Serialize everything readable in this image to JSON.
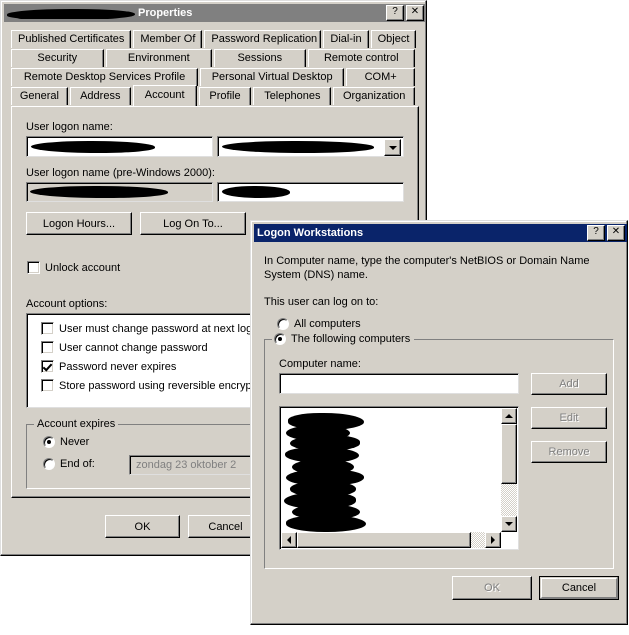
{
  "properties_window": {
    "title_suffix": "Properties",
    "title_redacted": true,
    "titlebar_buttons": [
      {
        "name": "help-button",
        "label": "?"
      },
      {
        "name": "close-button",
        "label": "✕"
      }
    ],
    "tab_rows": [
      [
        {
          "label": "Published Certificates",
          "active": false,
          "width": 124
        },
        {
          "label": "Member Of",
          "active": false,
          "width": 70
        },
        {
          "label": "Password Replication",
          "active": false,
          "width": 117
        },
        {
          "label": "Dial-in",
          "active": false,
          "width": 48
        },
        {
          "label": "Object",
          "active": false,
          "width": 45
        }
      ],
      [
        {
          "label": "Security",
          "active": false,
          "width": 93
        },
        {
          "label": "Environment",
          "active": false,
          "width": 107
        },
        {
          "label": "Sessions",
          "active": false,
          "width": 92
        },
        {
          "label": "Remote control",
          "active": false,
          "width": 108
        }
      ],
      [
        {
          "label": "Remote Desktop Services Profile",
          "active": false,
          "width": 188
        },
        {
          "label": "Personal Virtual Desktop",
          "active": false,
          "width": 145
        },
        {
          "label": "COM+",
          "active": false,
          "width": 69
        }
      ],
      [
        {
          "label": "General",
          "active": false,
          "width": 57
        },
        {
          "label": "Address",
          "active": false,
          "width": 61
        },
        {
          "label": "Account",
          "active": true,
          "width": 64
        },
        {
          "label": "Profile",
          "active": false,
          "width": 53
        },
        {
          "label": "Telephones",
          "active": false,
          "width": 78
        },
        {
          "label": "Organization",
          "active": false,
          "width": 82
        }
      ]
    ],
    "account_tab": {
      "user_logon_name_label": "User logon name:",
      "user_logon_name_value": "",
      "user_logon_domain_value": "",
      "user_logon_pre2000_label": "User logon name (pre-Windows 2000):",
      "user_logon_pre2000_domain_value": "",
      "user_logon_pre2000_value": "",
      "logon_hours_button": "Logon Hours...",
      "log_on_to_button": "Log On To...",
      "unlock_account_label": "Unlock account",
      "unlock_account_checked": false,
      "account_options_label": "Account options:",
      "account_options": [
        {
          "label": "User must change password at next logon",
          "checked": false
        },
        {
          "label": "User cannot change password",
          "checked": false
        },
        {
          "label": "Password never expires",
          "checked": true
        },
        {
          "label": "Store password using reversible encryption",
          "checked": false
        }
      ],
      "account_expires_group": "Account expires",
      "expires_never_label": "Never",
      "expires_never_checked": true,
      "expires_end_of_label": "End of:",
      "expires_end_of_checked": false,
      "expires_date_value": "zondag   23   oktober   2"
    },
    "buttons": [
      {
        "name": "ok-button",
        "label": "OK",
        "disabled": false
      },
      {
        "name": "cancel-button",
        "label": "Cancel",
        "disabled": false
      }
    ]
  },
  "logon_workstations_dialog": {
    "title": "Logon Workstations",
    "titlebar_buttons": [
      {
        "name": "help-button",
        "label": "?"
      },
      {
        "name": "close-button",
        "label": "✕"
      }
    ],
    "description_line1": "In Computer name, type the computer's NetBIOS or Domain Name",
    "description_line2": "System (DNS) name.",
    "prompt": "This user can log on to:",
    "radio_all_computers": "All computers",
    "radio_all_computers_checked": false,
    "radio_following_computers": "The following computers",
    "radio_following_computers_checked": true,
    "computer_name_label": "Computer name:",
    "computer_name_value": "",
    "side_buttons": [
      {
        "name": "add-button",
        "label": "Add",
        "disabled": true
      },
      {
        "name": "edit-button",
        "label": "Edit",
        "disabled": true
      },
      {
        "name": "remove-button",
        "label": "Remove",
        "disabled": true
      }
    ],
    "list_redacted": true,
    "buttons": [
      {
        "name": "ok-button",
        "label": "OK",
        "disabled": true
      },
      {
        "name": "cancel-button",
        "label": "Cancel",
        "disabled": false,
        "default": true
      }
    ]
  },
  "colors": {
    "face": "#d4d0c8",
    "active_title": "#0a246a",
    "inactive_title": "#808080",
    "disabled_text": "#808080",
    "desktop": "#ffffff"
  }
}
